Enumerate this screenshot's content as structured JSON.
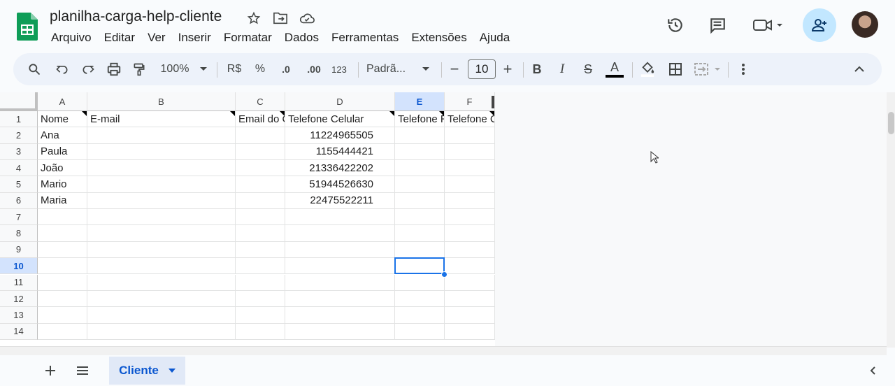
{
  "document": {
    "title": "planilha-carga-help-cliente"
  },
  "menu": [
    "Arquivo",
    "Editar",
    "Ver",
    "Inserir",
    "Formatar",
    "Dados",
    "Ferramentas",
    "Extensões",
    "Ajuda"
  ],
  "toolbar": {
    "zoom": "100%",
    "currency": "R$",
    "percent": "%",
    "decrease_decimal": ".0",
    "increase_decimal": ".00",
    "number_format": "123",
    "font": "Padrã...",
    "font_size": "10",
    "minus": "−",
    "plus": "+",
    "bold": "B",
    "italic": "I",
    "strike": "S",
    "text_color": "A"
  },
  "sheet": {
    "columns": [
      "A",
      "B",
      "C",
      "D",
      "E",
      "F"
    ],
    "selected_column": "E",
    "rows": [
      "1",
      "2",
      "3",
      "4",
      "5",
      "6",
      "7",
      "8",
      "9",
      "10",
      "11",
      "12",
      "13",
      "14"
    ],
    "selected_row": "10",
    "header_row": [
      "Nome",
      "E-mail",
      "Email do Cliente",
      "Telefone Celular",
      "Telefone Residencial",
      "Telefone Comercial"
    ],
    "data": [
      [
        "Ana",
        "",
        "",
        "11224965505",
        "",
        ""
      ],
      [
        "Paula",
        "",
        "",
        "1155444421",
        "",
        ""
      ],
      [
        "João",
        "",
        "",
        "21336422202",
        "",
        ""
      ],
      [
        "Mario",
        "",
        "",
        "51944526630",
        "",
        ""
      ],
      [
        "Maria",
        "",
        "",
        "22475522211",
        "",
        ""
      ]
    ]
  },
  "tabs": [
    {
      "label": "Cliente",
      "active": true
    }
  ],
  "colors": {
    "accent": "#0b57d0",
    "share_bg": "#c2e7ff",
    "toolbar_bg": "#edf2fa",
    "selection": "#1a73e8"
  }
}
